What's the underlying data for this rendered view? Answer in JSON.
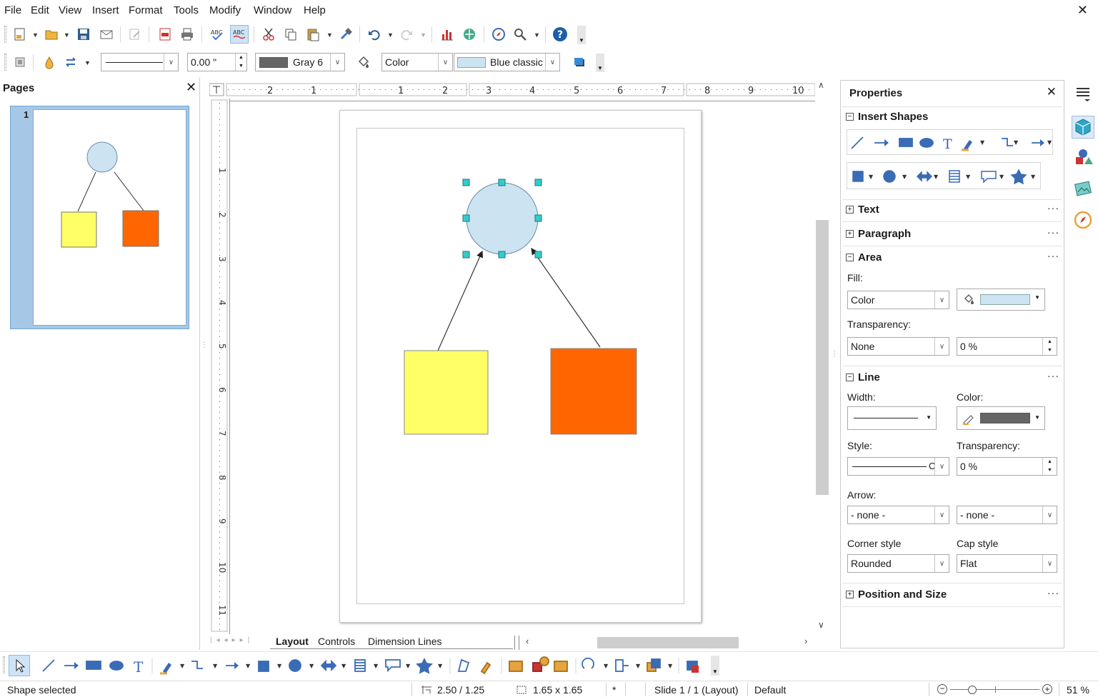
{
  "menubar": {
    "items": [
      "File",
      "Edit",
      "View",
      "Insert",
      "Format",
      "Tools",
      "Modify",
      "Window",
      "Help"
    ],
    "close_doc": "✕"
  },
  "line_toolbar": {
    "line_width_value": "0.00 \"",
    "line_color_label": "Gray 6",
    "area_fill_type": "Color",
    "area_fill_color_label": "Blue classic"
  },
  "pages_panel": {
    "title": "Pages",
    "close": "✕",
    "page_number": "1"
  },
  "ruler": {
    "h_ticks": [
      "2",
      "1",
      "1",
      "2",
      "3",
      "4",
      "5",
      "6",
      "7",
      "8",
      "9",
      "10"
    ],
    "v_ticks": [
      "1",
      "2",
      "3",
      "4",
      "5",
      "6",
      "7",
      "8",
      "9",
      "10",
      "11"
    ]
  },
  "drawing": {
    "circle_color": "#cce3f2",
    "yellow_color": "#ffff66",
    "orange_color": "#ff6600",
    "handle_color": "#33cccc"
  },
  "layer_tabs": [
    "Layout",
    "Controls",
    "Dimension Lines"
  ],
  "sidebar": {
    "title": "Properties",
    "close": "✕",
    "insert_shapes": "Insert Shapes",
    "text": "Text",
    "paragraph": "Paragraph",
    "area": "Area",
    "fill_label": "Fill:",
    "fill_value": "Color",
    "fill_color": "#cce3f2",
    "transparency_label": "Transparency:",
    "transparency_type": "None",
    "transparency_value": "0 %",
    "line": "Line",
    "width_label": "Width:",
    "color_label": "Color:",
    "line_color": "#666666",
    "style_label": "Style:",
    "line_transparency_label": "Transparency:",
    "line_transparency_value": "0 %",
    "arrow_label": "Arrow:",
    "arrow_start": "- none -",
    "arrow_end": "- none -",
    "corner_style_label": "Corner style",
    "corner_style_value": "Rounded",
    "cap_style_label": "Cap style",
    "cap_style_value": "Flat",
    "position_size": "Position and Size",
    "more": "···",
    "collapse": "−",
    "expand": "+"
  },
  "statusbar": {
    "status": "Shape selected",
    "position": "2.50 / 1.25",
    "size": "1.65 x 1.65",
    "modified": "*",
    "slide": "Slide 1 / 1 (Layout)",
    "master": "Default",
    "zoom": "51 %"
  }
}
